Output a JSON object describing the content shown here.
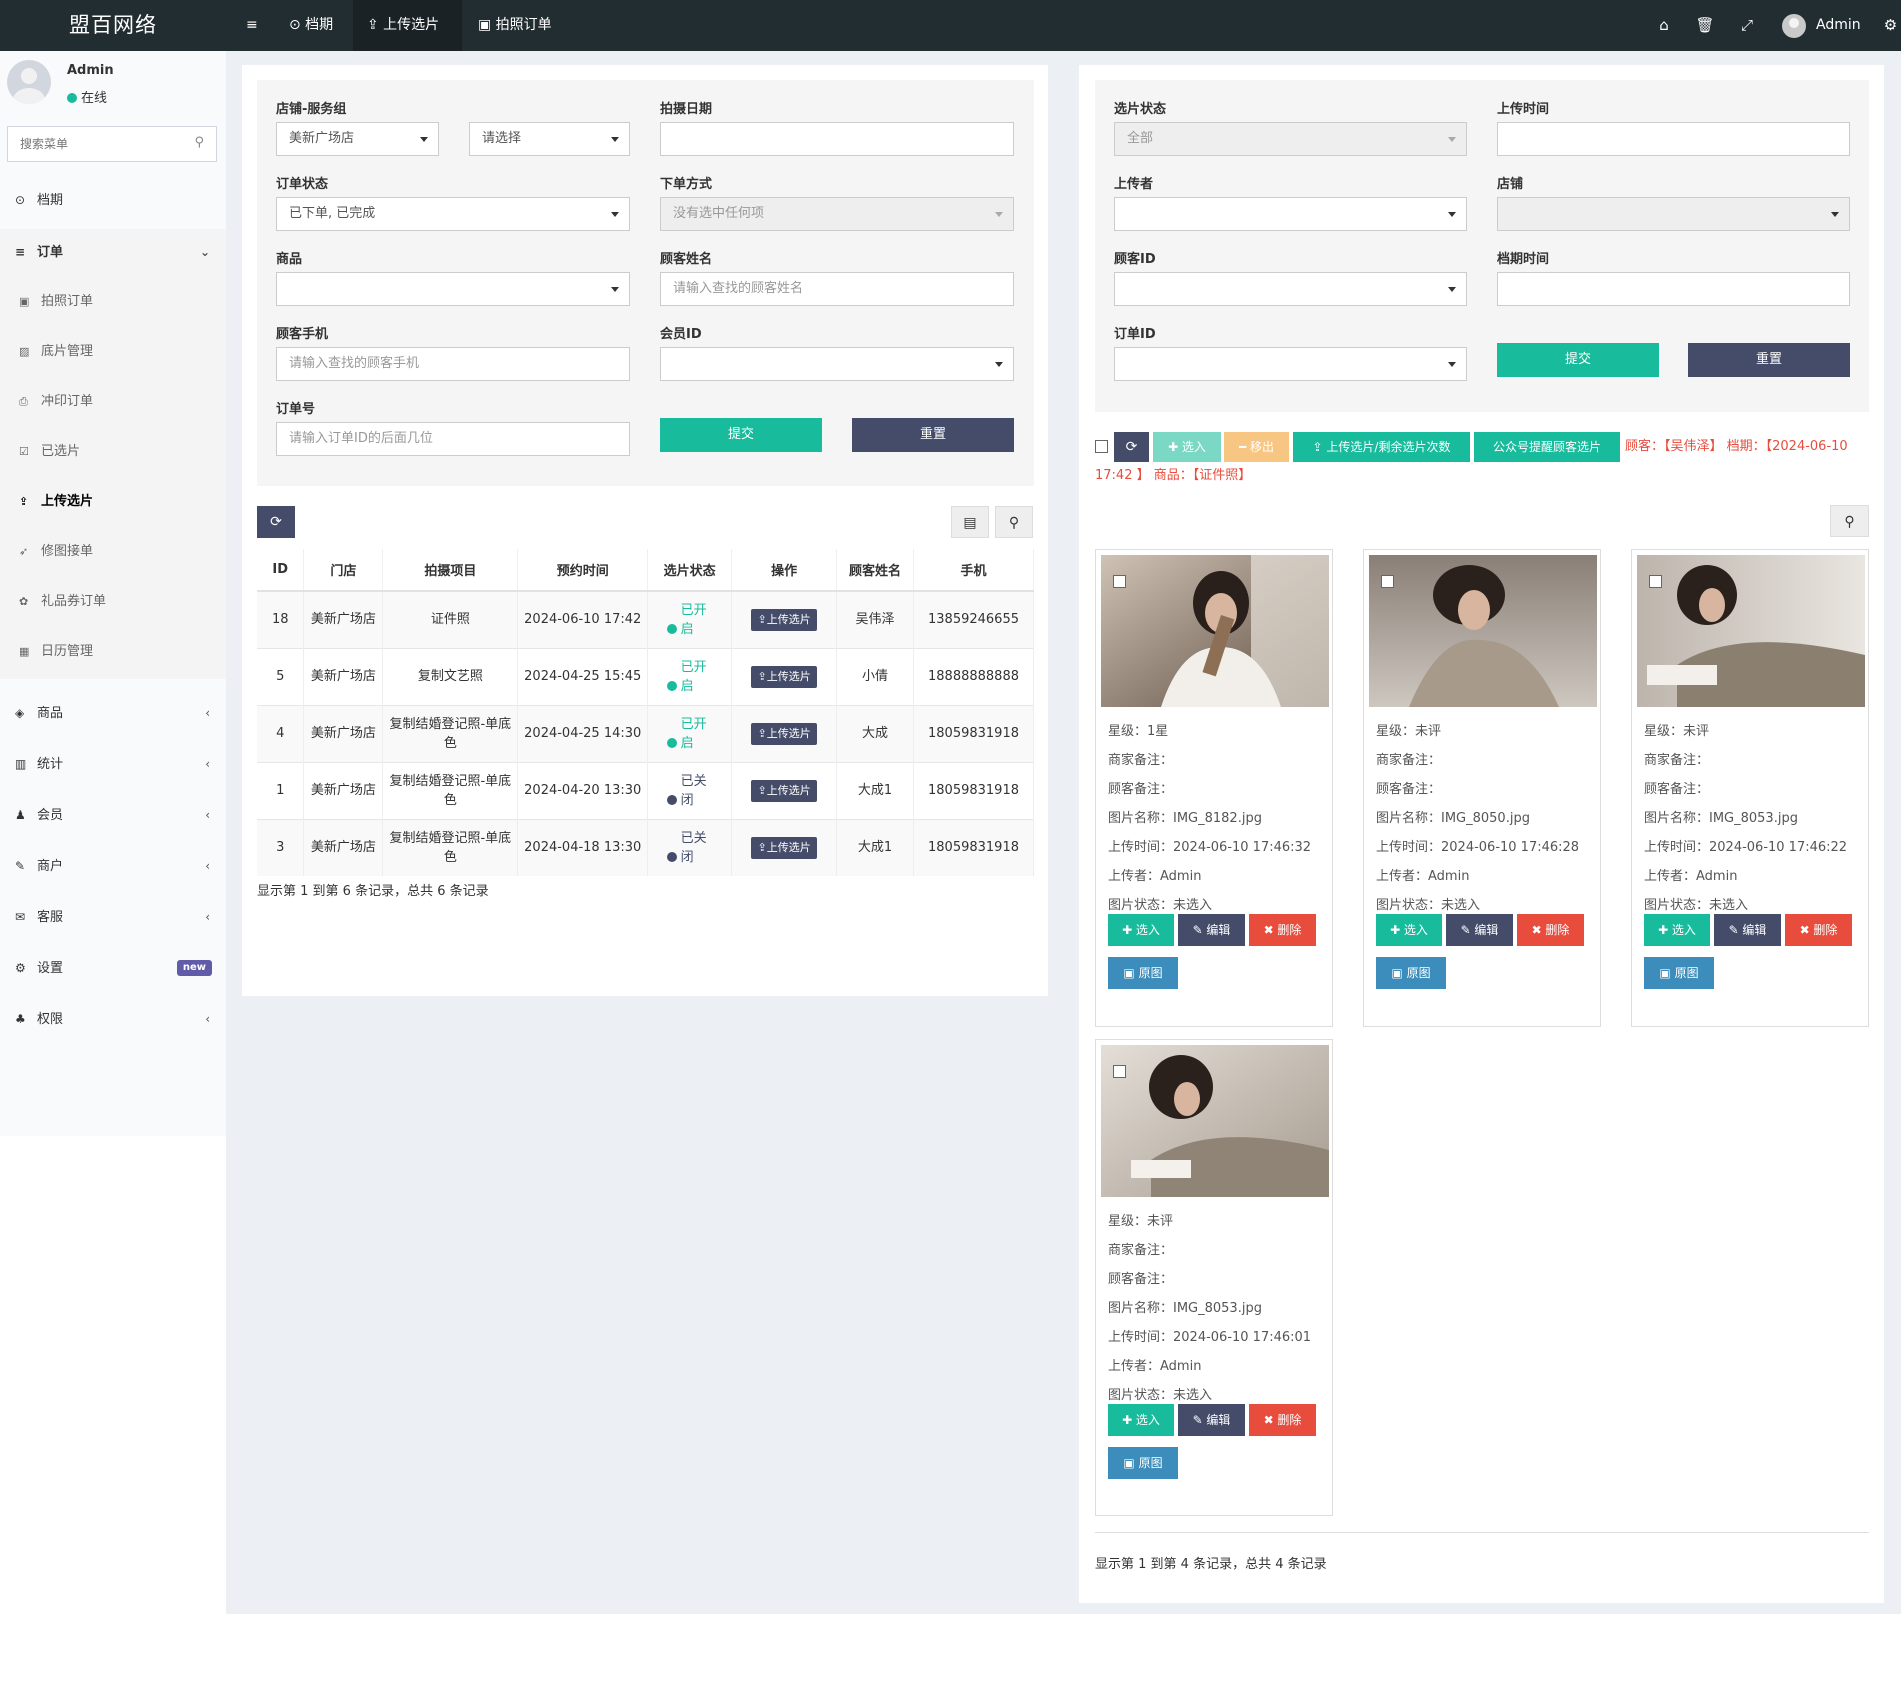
{
  "app": {
    "brand": "盟百网络"
  },
  "topbar": {
    "nav": [
      {
        "label": "≡",
        "icon": "menu-icon"
      },
      {
        "label": "⊙ 档期",
        "icon": "clock-icon"
      },
      {
        "label": "⇪ 上传选片",
        "icon": "upload-icon"
      },
      {
        "label": "▣ 拍照订单",
        "icon": "camera-icon"
      }
    ],
    "user": "Admin"
  },
  "sidebar": {
    "user_name": "Admin",
    "user_status": "在线",
    "search_placeholder": "搜索菜单",
    "items": [
      {
        "label": "档期",
        "icon": "⊙"
      },
      {
        "label": "订单",
        "icon": "≡"
      },
      {
        "label": "商品",
        "icon": "◈"
      },
      {
        "label": "统计",
        "icon": "▥"
      },
      {
        "label": "会员",
        "icon": "♟"
      },
      {
        "label": "商户",
        "icon": "✎"
      },
      {
        "label": "客服",
        "icon": "✉"
      },
      {
        "label": "设置",
        "icon": "⚙",
        "badge": "new"
      },
      {
        "label": "权限",
        "icon": "♣"
      }
    ],
    "order_sub": [
      {
        "label": "拍照订单",
        "icon": "▣"
      },
      {
        "label": "底片管理",
        "icon": "▨"
      },
      {
        "label": "冲印订单",
        "icon": "⎙"
      },
      {
        "label": "已选片",
        "icon": "☑"
      },
      {
        "label": "上传选片",
        "icon": "⇪"
      },
      {
        "label": "修图接单",
        "icon": "➶"
      },
      {
        "label": "礼品券订单",
        "icon": "✿"
      },
      {
        "label": "日历管理",
        "icon": "▦"
      }
    ]
  },
  "left_form": {
    "store_label": "店铺-服务组",
    "store_value": "美新广场店",
    "group_value": "请选择",
    "date_label": "拍摄日期",
    "order_status_label": "订单状态",
    "order_status_value": "已下单, 已完成",
    "order_method_label": "下单方式",
    "order_method_value": "没有选中任何项",
    "product_label": "商品",
    "customer_name_label": "顾客姓名",
    "customer_name_ph": "请输入查找的顾客姓名",
    "phone_label": "顾客手机",
    "phone_ph": "请输入查找的顾客手机",
    "member_label": "会员ID",
    "order_no_label": "订单号",
    "order_no_ph": "请输入订单ID的后面几位",
    "submit": "提交",
    "reset": "重置"
  },
  "table": {
    "headers": [
      "ID",
      "门店",
      "拍摄项目",
      "预约时间",
      "选片状态",
      "操作",
      "顾客姓名",
      "手机"
    ],
    "rows": [
      {
        "id": "18",
        "store": "美新广场店",
        "project": "证件照",
        "time": "2024-06-10 17:42",
        "status": "已开启",
        "open": true,
        "action": "上传选片",
        "name": "吴伟泽",
        "phone": "13859246655"
      },
      {
        "id": "5",
        "store": "美新广场店",
        "project": "复制文艺照",
        "time": "2024-04-25 15:45",
        "status": "已开启",
        "open": true,
        "action": "上传选片",
        "name": "小倩",
        "phone": "18888888888"
      },
      {
        "id": "4",
        "store": "美新广场店",
        "project": "复制结婚登记照-单底色",
        "time": "2024-04-25 14:30",
        "status": "已开启",
        "open": true,
        "action": "上传选片",
        "name": "大成",
        "phone": "18059831918"
      },
      {
        "id": "1",
        "store": "美新广场店",
        "project": "复制结婚登记照-单底色",
        "time": "2024-04-20 13:30",
        "status": "已关闭",
        "open": false,
        "action": "上传选片",
        "name": "大成1",
        "phone": "18059831918"
      },
      {
        "id": "3",
        "store": "美新广场店",
        "project": "复制结婚登记照-单底色",
        "time": "2024-04-18 13:30",
        "status": "已关闭",
        "open": false,
        "action": "上传选片",
        "name": "大成1",
        "phone": "18059831918"
      }
    ],
    "footer": "显示第 1 到第 6 条记录，总共 6 条记录"
  },
  "right_form": {
    "select_status_label": "选片状态",
    "select_status_value": "全部",
    "upload_time_label": "上传时间",
    "uploader_label": "上传者",
    "store_label": "店铺",
    "customer_id_label": "顾客ID",
    "schedule_time_label": "档期时间",
    "order_id_label": "订单ID",
    "submit": "提交",
    "reset": "重置"
  },
  "toolbar": {
    "select_in": "✚ 选入",
    "move_out": "━ 移出",
    "upload_count": "⇪ 上传选片/剩余选片次数",
    "remind": "公众号提醒顾客选片",
    "order_info": "顾客：【吴伟泽】 档期：【2024-06-10 17:42 】 商品：【证件照】"
  },
  "photos": [
    {
      "rating": "星级：1星",
      "merchant_note": "商家备注：",
      "customer_note": "顾客备注：",
      "filename": "图片名称：IMG_8182.jpg",
      "upload_time": "上传时间：2024-06-10 17:46:32",
      "uploader": "上传者：Admin",
      "status": "图片状态：未选入"
    },
    {
      "rating": "星级：未评",
      "merchant_note": "商家备注：",
      "customer_note": "顾客备注：",
      "filename": "图片名称：IMG_8050.jpg",
      "upload_time": "上传时间：2024-06-10 17:46:28",
      "uploader": "上传者：Admin",
      "status": "图片状态：未选入"
    },
    {
      "rating": "星级：未评",
      "merchant_note": "商家备注：",
      "customer_note": "顾客备注：",
      "filename": "图片名称：IMG_8053.jpg",
      "upload_time": "上传时间：2024-06-10 17:46:22",
      "uploader": "上传者：Admin",
      "status": "图片状态：未选入"
    },
    {
      "rating": "星级：未评",
      "merchant_note": "商家备注：",
      "customer_note": "顾客备注：",
      "filename": "图片名称：IMG_8053.jpg",
      "upload_time": "上传时间：2024-06-10 17:46:01",
      "uploader": "上传者：Admin",
      "status": "图片状态：未选入"
    }
  ],
  "photo_buttons": {
    "select": "✚ 选入",
    "edit": "✎ 编辑",
    "delete": "✖ 删除",
    "original": "▣ 原图"
  },
  "right_footer": "显示第 1 到第 4 条记录，总共 4 条记录",
  "colors": {
    "green": "#18bc9c",
    "navy": "#444c69",
    "red": "#e74c3c",
    "orange": "#f39c12",
    "blue": "#3c8dbc",
    "topbar": "#222d32"
  }
}
